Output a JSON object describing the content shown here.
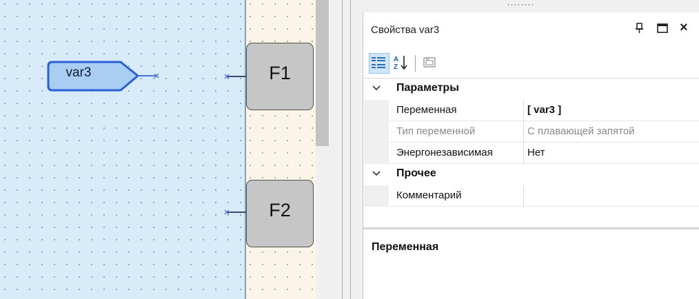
{
  "diagram": {
    "variable_block": {
      "label": "var3"
    },
    "function_blocks": [
      {
        "label": "F1"
      },
      {
        "label": "F2"
      }
    ]
  },
  "properties_panel": {
    "title": "Свойства var3",
    "toolbar": {
      "categorized_icon": "categorized-view-icon",
      "alphabetical_icon": "sort-az-icon",
      "property_pages_icon": "property-pages-icon"
    },
    "categories": [
      {
        "label": "Параметры",
        "expanded": true,
        "properties": [
          {
            "name": "Переменная",
            "value": "[ var3 ]"
          },
          {
            "name": "Тип переменной",
            "value": "С плавающей запятой"
          },
          {
            "name": "Энергонезависимая",
            "value": "Нет"
          }
        ]
      },
      {
        "label": "Прочее",
        "expanded": true,
        "properties": [
          {
            "name": "Комментарий",
            "value": ""
          }
        ]
      }
    ],
    "description": {
      "title": "Переменная"
    }
  },
  "colors": {
    "canvas_blue": "#d7ebf8",
    "canvas_beige": "#fbf5e7",
    "variable_fill": "#a9cdf3",
    "variable_border": "#2a5fd8",
    "function_fill": "#c6c6c6",
    "wire": "#4a6fd8",
    "toolbar_selected": "#cde6fb"
  }
}
